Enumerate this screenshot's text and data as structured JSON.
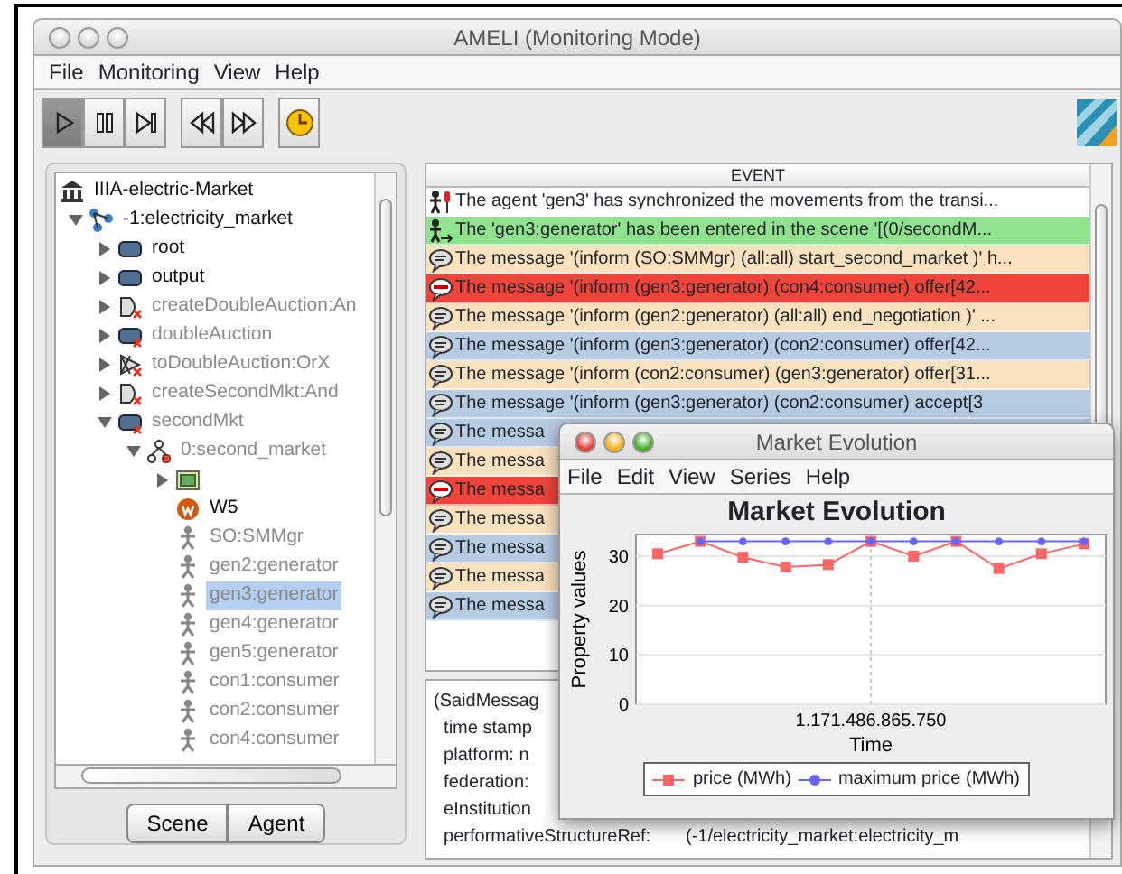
{
  "window": {
    "title": "AMELI (Monitoring Mode)"
  },
  "menu": [
    "File",
    "Monitoring",
    "View",
    "Help"
  ],
  "toolbar": [
    [
      {
        "kind": "play",
        "pressed": true
      },
      {
        "kind": "pause",
        "pressed": false
      },
      {
        "kind": "step",
        "pressed": false
      }
    ],
    [
      {
        "kind": "rewind",
        "pressed": false
      },
      {
        "kind": "forward",
        "pressed": false
      }
    ],
    [
      {
        "kind": "clock",
        "pressed": false
      }
    ]
  ],
  "tree": {
    "items": [
      {
        "kind": "institution",
        "label": "IIIA-electric-Market",
        "disabled": false,
        "selected": false,
        "children": [
          {
            "kind": "structure",
            "label": "-1:electricity_market",
            "disabled": false,
            "selected": false,
            "expanded": true,
            "children": [
              {
                "kind": "scene",
                "label": "root",
                "disabled": false,
                "selected": false,
                "expanded": false
              },
              {
                "kind": "scene",
                "label": "output",
                "disabled": false,
                "selected": false,
                "expanded": false
              },
              {
                "kind": "transition",
                "label": "createDoubleAuction:An",
                "disabled": true,
                "selected": false,
                "expanded": false
              },
              {
                "kind": "scene",
                "label": "doubleAuction",
                "disabled": true,
                "selected": false,
                "expanded": false
              },
              {
                "kind": "orx",
                "label": "toDoubleAuction:OrX",
                "disabled": true,
                "selected": false,
                "expanded": false
              },
              {
                "kind": "transition",
                "label": "createSecondMkt:And",
                "disabled": true,
                "selected": false,
                "expanded": false
              },
              {
                "kind": "scene",
                "label": "secondMkt",
                "disabled": true,
                "selected": false,
                "expanded": true,
                "children": [
                  {
                    "kind": "instance",
                    "label": "0:second_market",
                    "disabled": true,
                    "selected": false,
                    "expanded": true,
                    "children": [
                      {
                        "kind": "folder",
                        "expanded": false
                      },
                      {
                        "kind": "badge",
                        "label": "W5",
                        "disabled": false,
                        "selected": false
                      },
                      {
                        "kind": "agent",
                        "label": "SO:SMMgr",
                        "disabled": true,
                        "selected": false
                      },
                      {
                        "kind": "agent",
                        "label": "gen2:generator",
                        "disabled": true,
                        "selected": false
                      },
                      {
                        "kind": "agent",
                        "label": "gen3:generator",
                        "disabled": true,
                        "selected": true
                      },
                      {
                        "kind": "agent",
                        "label": "gen4:generator",
                        "disabled": true,
                        "selected": false
                      },
                      {
                        "kind": "agent",
                        "label": "gen5:generator",
                        "disabled": true,
                        "selected": false
                      },
                      {
                        "kind": "agent",
                        "label": "con1:consumer",
                        "disabled": true,
                        "selected": false
                      },
                      {
                        "kind": "agent",
                        "label": "con2:consumer",
                        "disabled": true,
                        "selected": false
                      },
                      {
                        "kind": "agent",
                        "label": "con4:consumer",
                        "disabled": true,
                        "selected": false
                      }
                    ]
                  }
                ]
              }
            ]
          }
        ]
      }
    ]
  },
  "tabs": [
    {
      "label": "Scene"
    },
    {
      "label": "Agent"
    }
  ],
  "events": {
    "column": "EVENT",
    "rows": [
      {
        "kind": "sync",
        "color": "#ffffff",
        "text": "The agent 'gen3' has synchronized the movements from the transi..."
      },
      {
        "kind": "enter",
        "color": "#8fe38f",
        "text": "The 'gen3:generator' has been entered in the scene '[(0/secondM..."
      },
      {
        "kind": "message",
        "color": "#fbe2bf",
        "text": "The message '(inform (SO:SMMgr) (all:all) start_second_market )' h..."
      },
      {
        "kind": "rejected",
        "color": "#f0443a",
        "text": "The message '(inform (gen3:generator) (con4:consumer) offer[42..."
      },
      {
        "kind": "message",
        "color": "#fbe2bf",
        "text": "The message '(inform (gen2:generator) (all:all) end_negotiation )' ..."
      },
      {
        "kind": "message",
        "color": "#b7cbe3",
        "text": "The message '(inform (gen3:generator) (con2:consumer) offer[42..."
      },
      {
        "kind": "message",
        "color": "#fbe2bf",
        "text": "The message '(inform (con2:consumer) (gen3:generator) offer[31..."
      },
      {
        "kind": "message",
        "color": "#b7cbe3",
        "text": "The message '(inform (gen3:generator) (con2:consumer) accept[3"
      },
      {
        "kind": "message",
        "color": "#b7cbe3",
        "text": "The messa"
      },
      {
        "kind": "message",
        "color": "#fbe2bf",
        "text": "The messa"
      },
      {
        "kind": "rejected",
        "color": "#f0443a",
        "text": "The messa"
      },
      {
        "kind": "message",
        "color": "#fbe2bf",
        "text": "The messa"
      },
      {
        "kind": "message",
        "color": "#b7cbe3",
        "text": "The messa"
      },
      {
        "kind": "message",
        "color": "#fbe2bf",
        "text": "The messa"
      },
      {
        "kind": "message",
        "color": "#b7cbe3",
        "text": "The messa"
      }
    ]
  },
  "details": [
    "(SaidMessag",
    "  time stamp",
    "  platform: n",
    "  federation:",
    "  eInstitution",
    "  performativeStructureRef:       (-1/electricity_market:electricity_m"
  ],
  "chart_window": {
    "title": "Market Evolution",
    "menu": [
      "File",
      "Edit",
      "View",
      "Series",
      "Help"
    ],
    "chart_data": {
      "type": "line",
      "title": "Market Evolution",
      "xlabel": "Time",
      "ylabel": "Property values",
      "ylim": [
        0,
        34.4
      ],
      "yticks": [
        0,
        10,
        20,
        30
      ],
      "grid": true,
      "legend": true,
      "annotations": [
        "1.171.486.865.750"
      ],
      "series": [
        {
          "name": "price (MWh)",
          "color": "#ff6666",
          "marker": "square",
          "values": [
            30.5,
            33,
            29.8,
            27.8,
            28.3,
            33,
            30,
            33,
            27.5,
            30.5,
            32.5
          ]
        },
        {
          "name": "maximum price (MWh)",
          "color": "#6666ff",
          "marker": "circle",
          "values": [
            null,
            33,
            33,
            33,
            33,
            33,
            33,
            33,
            33,
            33,
            33
          ]
        }
      ]
    }
  }
}
